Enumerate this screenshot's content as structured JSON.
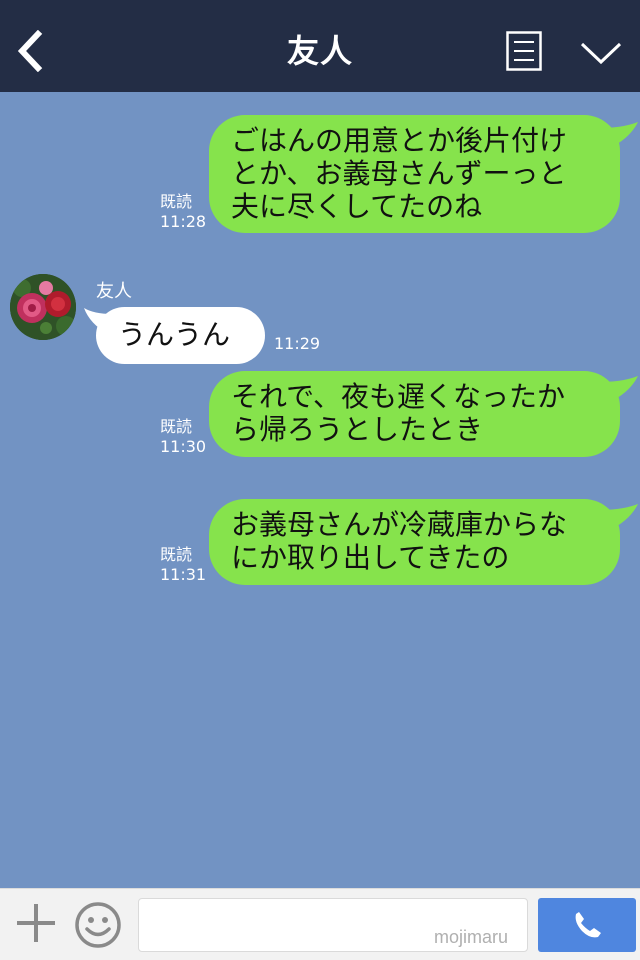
{
  "header": {
    "title": "友人"
  },
  "messages": [
    {
      "type": "sent",
      "text": "ごはんの用意とか後片付け\nとか、お義母さんずーっと\n夫に尽くしてたのね",
      "read": "既読",
      "time": "11:28"
    },
    {
      "type": "received",
      "sender": "友人",
      "text": "うんうん",
      "time": "11:29"
    },
    {
      "type": "sent",
      "text": "それで、夜も遅くなったか\nら帰ろうとしたとき",
      "read": "既読",
      "time": "11:30"
    },
    {
      "type": "sent",
      "text": "お義母さんが冷蔵庫からな\nにか取り出してきたの",
      "read": "既読",
      "time": "11:31"
    }
  ],
  "input": {
    "value": "",
    "placeholder": ""
  },
  "watermark": "mojimaru",
  "icons": {
    "back": "back-arrow-icon",
    "menu": "document-list-icon",
    "chevron": "chevron-down-icon",
    "plus": "plus-icon",
    "emoji": "smiley-icon",
    "call": "phone-icon",
    "avatar": "rose-photo"
  },
  "colors": {
    "header_bg": "#232d45",
    "chat_bg": "#7293c3",
    "sent_bubble": "#86e34c",
    "received_bubble": "#ffffff",
    "call_button": "#4f86df"
  }
}
